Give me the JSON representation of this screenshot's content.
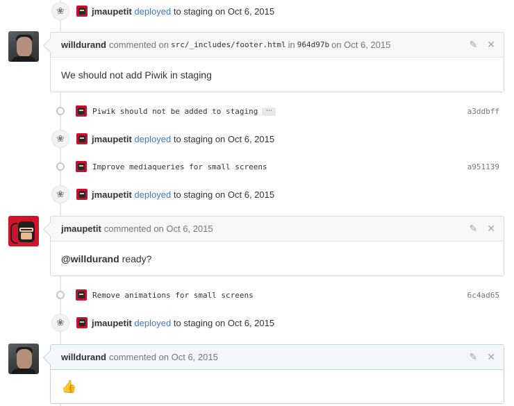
{
  "timeline": {
    "events": [
      {
        "actor": "jmaupetit",
        "action": "deployed",
        "rest": "to staging on Oct 6, 2015",
        "icon": "squirrel-icon"
      },
      {
        "actor": "jmaupetit",
        "action": "deployed",
        "rest": "to staging on Oct 6, 2015",
        "icon": "squirrel-icon"
      },
      {
        "actor": "jmaupetit",
        "action": "deployed",
        "rest": "to staging on Oct 6, 2015",
        "icon": "squirrel-icon"
      },
      {
        "actor": "jmaupetit",
        "action": "deployed",
        "rest": "to staging on Oct 6, 2015",
        "icon": "squirrel-icon"
      }
    ],
    "commits": [
      {
        "message": "Piwik should not be added to staging",
        "ellipsis": "⋯",
        "sha": "a3ddbff"
      },
      {
        "message": "Improve mediaqueries for small screens",
        "sha": "a951139"
      },
      {
        "message": "Remove animations for small screens",
        "sha": "6c4ad65"
      }
    ],
    "comments": [
      {
        "author": "willdurand",
        "pre": "commented on",
        "file": "src/_includes/footer.html",
        "in_word": "in",
        "commit": "964d97b",
        "date": "on Oct 6, 2015",
        "body": "We should not add Piwik in staging"
      },
      {
        "author": "jmaupetit",
        "pre": "commented on Oct 6, 2015",
        "mention": "@willdurand",
        "body": "ready?"
      },
      {
        "author": "willdurand",
        "pre": "commented on Oct 6, 2015",
        "body_emoji": "👍"
      }
    ],
    "actions": {
      "edit_icon": "✎",
      "close_icon": "✕"
    },
    "colors": {
      "link": "#4078c0",
      "line": "#e7e7e7"
    }
  }
}
